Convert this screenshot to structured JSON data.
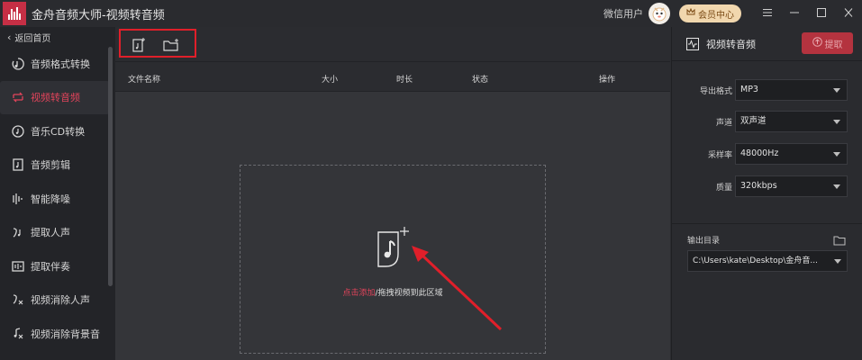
{
  "titlebar": {
    "app_title": "金舟音频大师-视频转音频",
    "user_label": "微信用户",
    "vip_label": "会员中心",
    "controls": [
      "minimize-icon",
      "maximize-icon",
      "close-icon"
    ]
  },
  "sidebar": {
    "back_label": "返回首页",
    "items": [
      {
        "label": "音频格式转换",
        "icon": "audio-convert-icon",
        "active": false
      },
      {
        "label": "视频转音频",
        "icon": "video-to-audio-icon",
        "active": true
      },
      {
        "label": "音乐CD转换",
        "icon": "cd-icon",
        "active": false
      },
      {
        "label": "音频剪辑",
        "icon": "audio-cut-icon",
        "active": false
      },
      {
        "label": "智能降噪",
        "icon": "denoise-icon",
        "active": false
      },
      {
        "label": "提取人声",
        "icon": "extract-vocal-icon",
        "active": false
      },
      {
        "label": "提取伴奏",
        "icon": "extract-accompaniment-icon",
        "active": false
      },
      {
        "label": "视频消除人声",
        "icon": "remove-vocal-icon",
        "active": false
      },
      {
        "label": "视频消除背景音",
        "icon": "remove-bgm-icon",
        "active": false
      }
    ]
  },
  "toolbar": {
    "add_file_icon": "add-file-icon",
    "add_folder_icon": "add-folder-icon"
  },
  "table": {
    "columns": [
      "文件名称",
      "大小",
      "时长",
      "状态",
      "操作"
    ]
  },
  "dropzone": {
    "link_text": "点击添加",
    "rest_text": "/拖拽视频到此区域"
  },
  "right_panel": {
    "title": "视频转音频",
    "extract_label": "提取",
    "options": [
      {
        "label": "导出格式",
        "value": "MP3"
      },
      {
        "label": "声道",
        "value": "双声道"
      },
      {
        "label": "采样率",
        "value": "48000Hz"
      },
      {
        "label": "质量",
        "value": "320kbps"
      }
    ],
    "output_label": "输出目录",
    "output_path": "C:\\Users\\kate\\Desktop\\金舟音..."
  },
  "colors": {
    "accent": "#e2445b",
    "annotation_red": "#e01f2a",
    "extract_button": "#b4333f"
  }
}
